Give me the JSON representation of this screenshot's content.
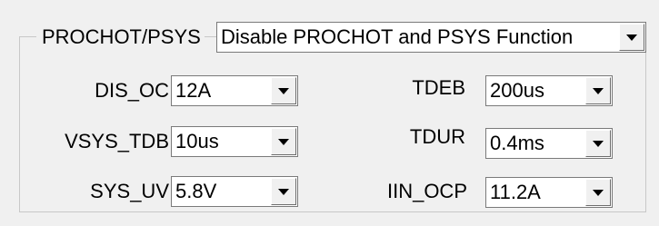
{
  "group": {
    "label": "PROCHOT/PSYS",
    "value": "Disable PROCHOT and PSYS Function"
  },
  "fields": {
    "dis_oc": {
      "label": "DIS_OC",
      "value": "12A"
    },
    "vsys_tdb": {
      "label": "VSYS_TDB",
      "value": "10us"
    },
    "sys_uv": {
      "label": "SYS_UV",
      "value": "5.8V"
    },
    "tdeb": {
      "label": "TDEB",
      "value": "200us"
    },
    "tdur": {
      "label": "TDUR",
      "value": "0.4ms"
    },
    "iin_ocp": {
      "label": "IIN_OCP",
      "value": "11.2A"
    }
  },
  "icons": {
    "dropdown": "chevron-down-icon"
  }
}
